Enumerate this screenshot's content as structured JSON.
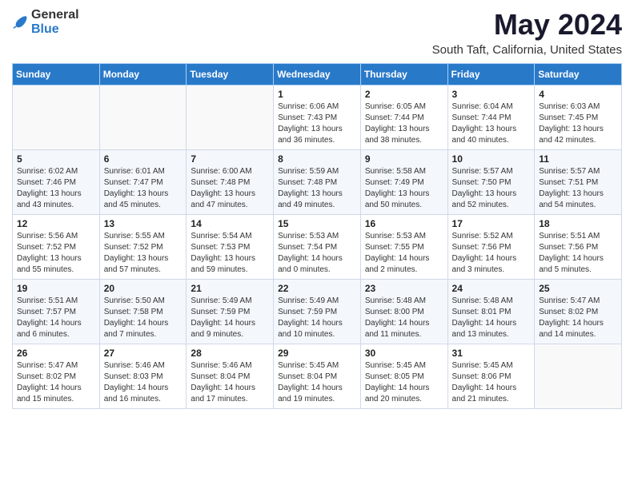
{
  "header": {
    "logo_general": "General",
    "logo_blue": "Blue",
    "title": "May 2024",
    "subtitle": "South Taft, California, United States"
  },
  "days_of_week": [
    "Sunday",
    "Monday",
    "Tuesday",
    "Wednesday",
    "Thursday",
    "Friday",
    "Saturday"
  ],
  "weeks": [
    [
      {
        "day": "",
        "detail": ""
      },
      {
        "day": "",
        "detail": ""
      },
      {
        "day": "",
        "detail": ""
      },
      {
        "day": "1",
        "detail": "Sunrise: 6:06 AM\nSunset: 7:43 PM\nDaylight: 13 hours\nand 36 minutes."
      },
      {
        "day": "2",
        "detail": "Sunrise: 6:05 AM\nSunset: 7:44 PM\nDaylight: 13 hours\nand 38 minutes."
      },
      {
        "day": "3",
        "detail": "Sunrise: 6:04 AM\nSunset: 7:44 PM\nDaylight: 13 hours\nand 40 minutes."
      },
      {
        "day": "4",
        "detail": "Sunrise: 6:03 AM\nSunset: 7:45 PM\nDaylight: 13 hours\nand 42 minutes."
      }
    ],
    [
      {
        "day": "5",
        "detail": "Sunrise: 6:02 AM\nSunset: 7:46 PM\nDaylight: 13 hours\nand 43 minutes."
      },
      {
        "day": "6",
        "detail": "Sunrise: 6:01 AM\nSunset: 7:47 PM\nDaylight: 13 hours\nand 45 minutes."
      },
      {
        "day": "7",
        "detail": "Sunrise: 6:00 AM\nSunset: 7:48 PM\nDaylight: 13 hours\nand 47 minutes."
      },
      {
        "day": "8",
        "detail": "Sunrise: 5:59 AM\nSunset: 7:48 PM\nDaylight: 13 hours\nand 49 minutes."
      },
      {
        "day": "9",
        "detail": "Sunrise: 5:58 AM\nSunset: 7:49 PM\nDaylight: 13 hours\nand 50 minutes."
      },
      {
        "day": "10",
        "detail": "Sunrise: 5:57 AM\nSunset: 7:50 PM\nDaylight: 13 hours\nand 52 minutes."
      },
      {
        "day": "11",
        "detail": "Sunrise: 5:57 AM\nSunset: 7:51 PM\nDaylight: 13 hours\nand 54 minutes."
      }
    ],
    [
      {
        "day": "12",
        "detail": "Sunrise: 5:56 AM\nSunset: 7:52 PM\nDaylight: 13 hours\nand 55 minutes."
      },
      {
        "day": "13",
        "detail": "Sunrise: 5:55 AM\nSunset: 7:52 PM\nDaylight: 13 hours\nand 57 minutes."
      },
      {
        "day": "14",
        "detail": "Sunrise: 5:54 AM\nSunset: 7:53 PM\nDaylight: 13 hours\nand 59 minutes."
      },
      {
        "day": "15",
        "detail": "Sunrise: 5:53 AM\nSunset: 7:54 PM\nDaylight: 14 hours\nand 0 minutes."
      },
      {
        "day": "16",
        "detail": "Sunrise: 5:53 AM\nSunset: 7:55 PM\nDaylight: 14 hours\nand 2 minutes."
      },
      {
        "day": "17",
        "detail": "Sunrise: 5:52 AM\nSunset: 7:56 PM\nDaylight: 14 hours\nand 3 minutes."
      },
      {
        "day": "18",
        "detail": "Sunrise: 5:51 AM\nSunset: 7:56 PM\nDaylight: 14 hours\nand 5 minutes."
      }
    ],
    [
      {
        "day": "19",
        "detail": "Sunrise: 5:51 AM\nSunset: 7:57 PM\nDaylight: 14 hours\nand 6 minutes."
      },
      {
        "day": "20",
        "detail": "Sunrise: 5:50 AM\nSunset: 7:58 PM\nDaylight: 14 hours\nand 7 minutes."
      },
      {
        "day": "21",
        "detail": "Sunrise: 5:49 AM\nSunset: 7:59 PM\nDaylight: 14 hours\nand 9 minutes."
      },
      {
        "day": "22",
        "detail": "Sunrise: 5:49 AM\nSunset: 7:59 PM\nDaylight: 14 hours\nand 10 minutes."
      },
      {
        "day": "23",
        "detail": "Sunrise: 5:48 AM\nSunset: 8:00 PM\nDaylight: 14 hours\nand 11 minutes."
      },
      {
        "day": "24",
        "detail": "Sunrise: 5:48 AM\nSunset: 8:01 PM\nDaylight: 14 hours\nand 13 minutes."
      },
      {
        "day": "25",
        "detail": "Sunrise: 5:47 AM\nSunset: 8:02 PM\nDaylight: 14 hours\nand 14 minutes."
      }
    ],
    [
      {
        "day": "26",
        "detail": "Sunrise: 5:47 AM\nSunset: 8:02 PM\nDaylight: 14 hours\nand 15 minutes."
      },
      {
        "day": "27",
        "detail": "Sunrise: 5:46 AM\nSunset: 8:03 PM\nDaylight: 14 hours\nand 16 minutes."
      },
      {
        "day": "28",
        "detail": "Sunrise: 5:46 AM\nSunset: 8:04 PM\nDaylight: 14 hours\nand 17 minutes."
      },
      {
        "day": "29",
        "detail": "Sunrise: 5:45 AM\nSunset: 8:04 PM\nDaylight: 14 hours\nand 19 minutes."
      },
      {
        "day": "30",
        "detail": "Sunrise: 5:45 AM\nSunset: 8:05 PM\nDaylight: 14 hours\nand 20 minutes."
      },
      {
        "day": "31",
        "detail": "Sunrise: 5:45 AM\nSunset: 8:06 PM\nDaylight: 14 hours\nand 21 minutes."
      },
      {
        "day": "",
        "detail": ""
      }
    ]
  ]
}
